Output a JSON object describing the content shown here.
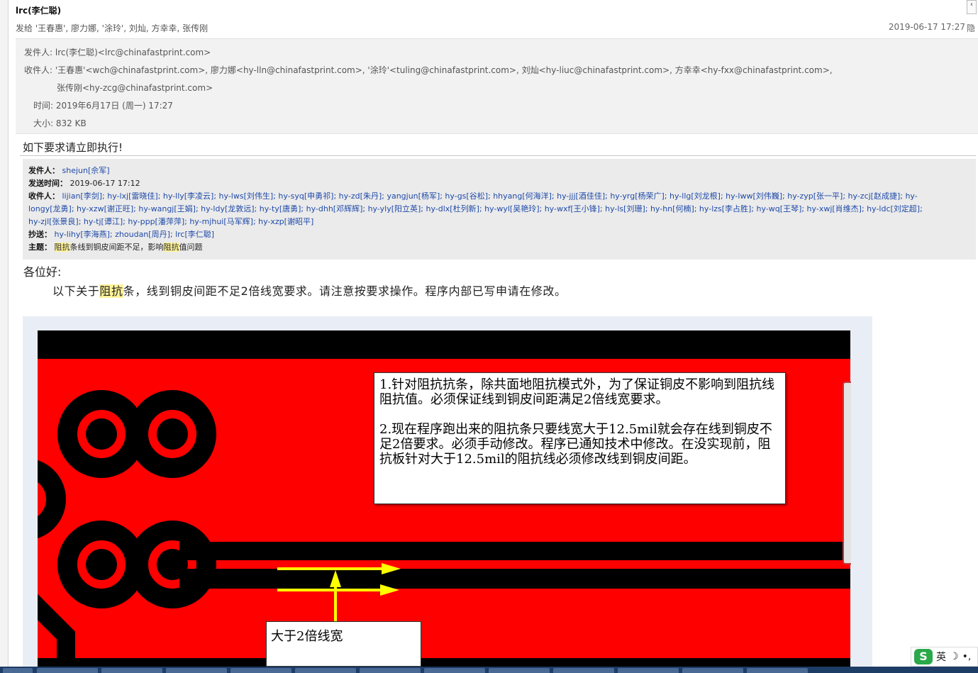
{
  "header": {
    "sender_name": "lrc(李仁聪)",
    "to_line": "发给 '王春惠', 廖力娜, '涂玲', 刘灿, 方幸幸, 张传刚",
    "date": "2019-06-17 17:27",
    "date_suffix": "隐"
  },
  "meta": {
    "from_label": "发件人:",
    "from_value": "lrc(李仁聪)<lrc@chinafastprint.com>",
    "to_label": "收件人:",
    "to_value_line1": "'王春惠'<wch@chinafastprint.com>, 廖力娜<hy-lln@chinafastprint.com>, '涂玲'<tuling@chinafastprint.com>, 刘灿<hy-liuc@chinafastprint.com>, 方幸幸<hy-fxx@chinafastprint.com>,",
    "to_value_line2": "张传刚<hy-zcg@chinafastprint.com>",
    "time_label": "时间:",
    "time_value": "2019年6月17日 (周一) 17:27",
    "size_label": "大小:",
    "size_value": "832 KB"
  },
  "body": {
    "intro": "如下要求请立即执行!",
    "greeting": "各位好:",
    "para_pre": "以下关于",
    "para_hl": "阻抗",
    "para_post": "条，线到铜皮间距不足2倍线宽要求。请注意按要求操作。程序内部已写申请在修改。"
  },
  "forward": {
    "from_label": "发件人：",
    "from_value": "shejun[佘军]",
    "sent_label": "发送时间：",
    "sent_value": "2019-06-17 17:12",
    "to_label": "收件人：",
    "to_line1": "lijian[李剑]; hy-lxj[雷晓佳]; hy-lly[李凌云]; hy-lws[刘伟生]; hy-syq[申勇祁]; hy-zd[朱丹]; yangjun[杨军]; hy-gs[谷松]; hhyang[何海洋]; hy-jjj[酒佳佳]; hy-yrg[杨荣广]; hy-llg[刘龙根]; hy-lww[刘伟巍]; hy-zyp[张一平]; hy-zcj[赵成捷]; hy-",
    "to_line2": "longy[龙勇]; hy-xzw[谢正旺]; hy-wangj[王娟]; hy-ldy[龙敦远]; hy-ty[唐勇]; hy-dhh[邓辉辉]; hy-yly[阳立英]; hy-dlx[杜列新]; hy-wyl[吴艳玲]; hy-wxf[王小锋]; hy-ls[刘珊]; hy-hn[何楠]; hy-lzs[李占胜]; hy-wq[王琴]; hy-xwj[肖维杰]; hy-ldc[刘定超];",
    "to_line3": "hy-zjl[张景良]; hy-tj[谭江]; hy-ppp[潘萍萍]; hy-mjhui[马军辉]; hy-xzp[谢昭平]",
    "cc_label": "抄送：",
    "cc_value": "hy-lihy[李海燕]; zhoudan[周丹]; lrc[李仁聪]",
    "subject_label": "主题：",
    "subject_hl1": "阻抗",
    "subject_mid": "条线到铜皮间距不足，影响",
    "subject_hl2": "阻抗",
    "subject_post": "值问题"
  },
  "image": {
    "note1": "1.针对阻抗抗条，除共面地阻抗模式外，为了保证铜皮不影响到阻抗线阻抗值。必须保证线到铜皮间距满足2倍线宽要求。\n\n2.现在程序跑出来的阻抗条只要线宽大于12.5mil就会存在线到铜皮不足2倍要求。必须手动修改。程序已通知技术中修改。在没实现前，阻抗板针对大于12.5mil的阻抗线必须修改线到铜皮间距。",
    "note2": "大于2倍线宽"
  },
  "ime": {
    "logo": "S",
    "mode": "英"
  },
  "colors": {
    "pcb_copper": "#ff0000",
    "trace": "#000000",
    "arrow": "#ffff00",
    "link": "#1f4aa8",
    "highlight": "#fff39a"
  }
}
